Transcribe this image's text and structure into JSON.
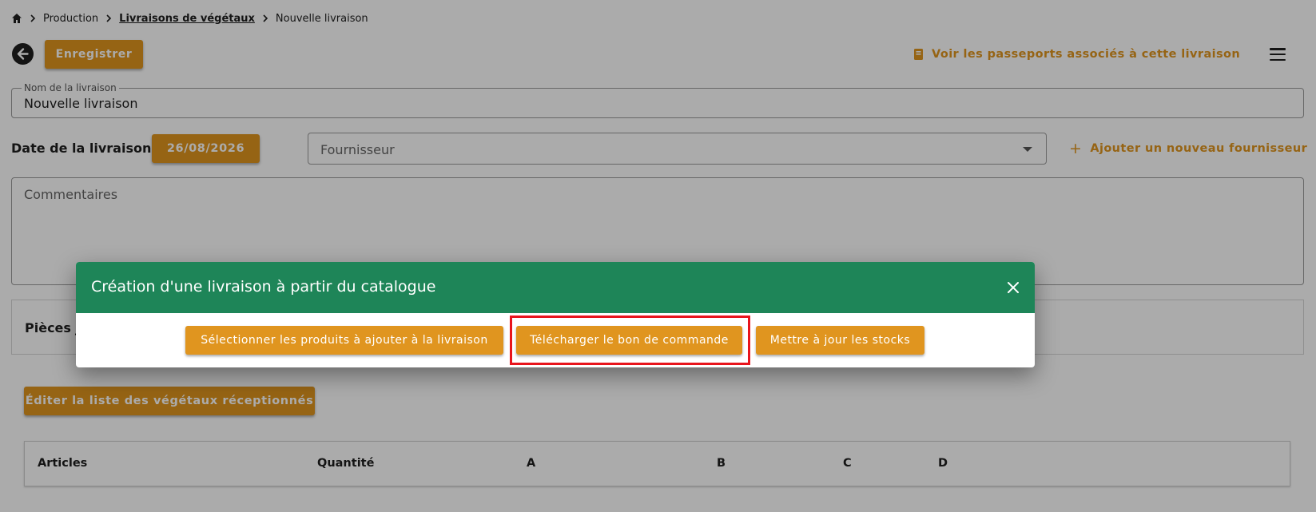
{
  "breadcrumb": {
    "items": [
      "Production",
      "Livraisons de végétaux",
      "Nouvelle livraison"
    ]
  },
  "toolbar": {
    "save_label": "Enregistrer",
    "passports_label": "Voir les passeports associés à cette livraison"
  },
  "form": {
    "name_legend": "Nom de la livraison",
    "name_value": "Nouvelle livraison",
    "date_label": "Date de la livraison:",
    "date_value": "26/08/2026",
    "supplier_placeholder": "Fournisseur",
    "add_supplier_label": "Ajouter un nouveau fournisseur",
    "comments_placeholder": "Commentaires"
  },
  "attachments": {
    "title_visible": "Pièces j"
  },
  "edit_list_label": "Éditer la liste des végétaux réceptionnés",
  "table": {
    "headers": [
      "Articles",
      "Quantité",
      "A",
      "B",
      "C",
      "D"
    ]
  },
  "dialog": {
    "title": "Création d'une livraison à partir du catalogue",
    "actions": [
      "Sélectionner les produits à ajouter à la livraison",
      "Télécharger le bon de commande",
      "Mettre à jour les stocks"
    ]
  },
  "colors": {
    "accent": "#e0951f",
    "dialog_header": "#1e8558",
    "highlight": "#e8141c"
  },
  "icons": [
    "home-icon",
    "chevron-right-icon",
    "arrow-left-icon",
    "book-icon",
    "menu-icon",
    "chevron-down-icon",
    "plus-icon",
    "close-icon"
  ]
}
